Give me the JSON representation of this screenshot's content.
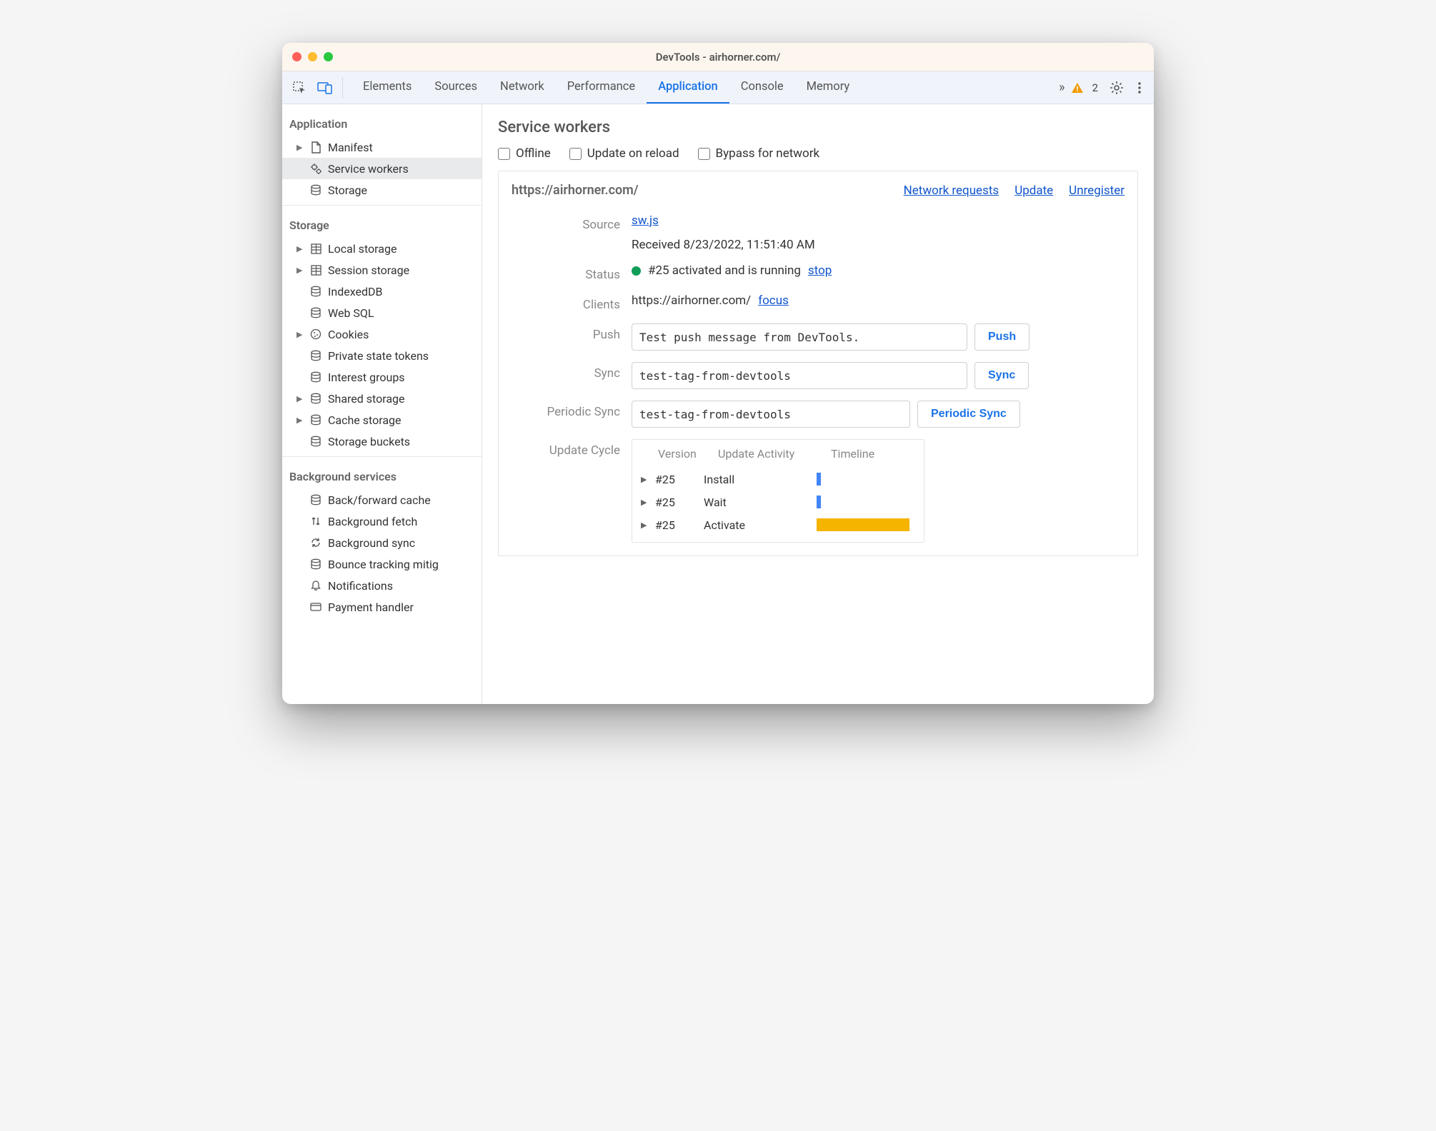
{
  "window": {
    "title": "DevTools - airhorner.com/"
  },
  "toolbar": {
    "tabs": [
      "Elements",
      "Sources",
      "Network",
      "Performance",
      "Application",
      "Console",
      "Memory"
    ],
    "active_tab": "Application",
    "warning_count": "2"
  },
  "sidebar": {
    "sections": {
      "application": {
        "title": "Application",
        "items": [
          {
            "label": "Manifest",
            "icon": "file",
            "expandable": true
          },
          {
            "label": "Service workers",
            "icon": "gears",
            "selected": true
          },
          {
            "label": "Storage",
            "icon": "database"
          }
        ]
      },
      "storage": {
        "title": "Storage",
        "items": [
          {
            "label": "Local storage",
            "icon": "grid",
            "expandable": true
          },
          {
            "label": "Session storage",
            "icon": "grid",
            "expandable": true
          },
          {
            "label": "IndexedDB",
            "icon": "database"
          },
          {
            "label": "Web SQL",
            "icon": "database"
          },
          {
            "label": "Cookies",
            "icon": "cookie",
            "expandable": true
          },
          {
            "label": "Private state tokens",
            "icon": "database"
          },
          {
            "label": "Interest groups",
            "icon": "database"
          },
          {
            "label": "Shared storage",
            "icon": "database",
            "expandable": true
          },
          {
            "label": "Cache storage",
            "icon": "database",
            "expandable": true
          },
          {
            "label": "Storage buckets",
            "icon": "database"
          }
        ]
      },
      "background": {
        "title": "Background services",
        "items": [
          {
            "label": "Back/forward cache",
            "icon": "database"
          },
          {
            "label": "Background fetch",
            "icon": "arrows"
          },
          {
            "label": "Background sync",
            "icon": "sync"
          },
          {
            "label": "Bounce tracking mitig",
            "icon": "database"
          },
          {
            "label": "Notifications",
            "icon": "bell"
          },
          {
            "label": "Payment handler",
            "icon": "card"
          }
        ]
      }
    }
  },
  "main": {
    "title": "Service workers",
    "checks": {
      "offline": "Offline",
      "update_on_reload": "Update on reload",
      "bypass": "Bypass for network"
    },
    "sw": {
      "origin": "https://airhorner.com/",
      "links": {
        "network_requests": "Network requests",
        "update": "Update",
        "unregister": "Unregister"
      },
      "labels": {
        "source": "Source",
        "status": "Status",
        "clients": "Clients",
        "push": "Push",
        "sync": "Sync",
        "periodic_sync": "Periodic Sync",
        "update_cycle": "Update Cycle"
      },
      "source": {
        "file": "sw.js",
        "received": "Received 8/23/2022, 11:51:40 AM"
      },
      "status": {
        "text": "#25 activated and is running",
        "stop": "stop"
      },
      "clients": {
        "url": "https://airhorner.com/",
        "focus": "focus"
      },
      "push": {
        "value": "Test push message from DevTools.",
        "button": "Push"
      },
      "sync": {
        "value": "test-tag-from-devtools",
        "button": "Sync"
      },
      "periodic_sync": {
        "value": "test-tag-from-devtools",
        "button": "Periodic Sync"
      },
      "update_cycle": {
        "headers": {
          "version": "Version",
          "activity": "Update Activity",
          "timeline": "Timeline"
        },
        "rows": [
          {
            "version": "#25",
            "activity": "Install",
            "timeline": "tick"
          },
          {
            "version": "#25",
            "activity": "Wait",
            "timeline": "tick"
          },
          {
            "version": "#25",
            "activity": "Activate",
            "timeline": "bar"
          }
        ]
      }
    }
  }
}
